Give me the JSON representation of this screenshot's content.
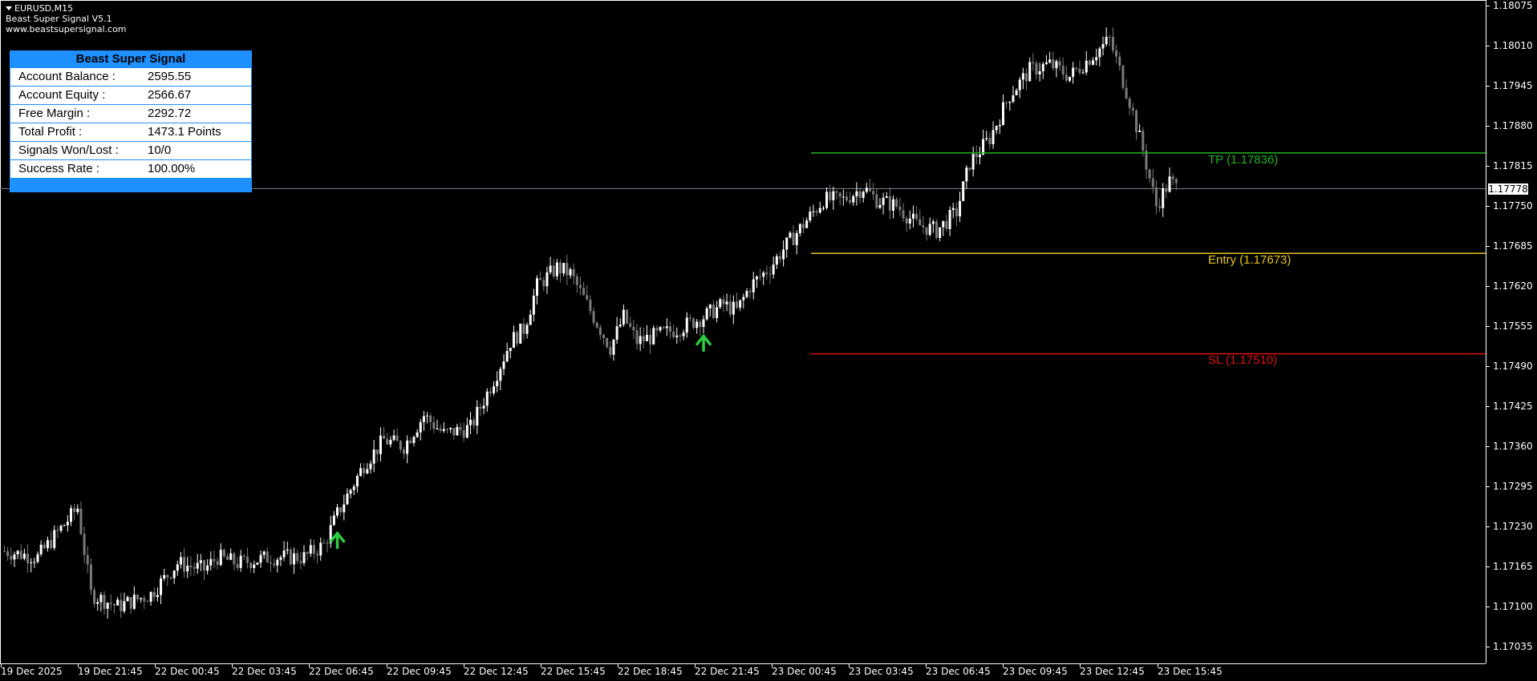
{
  "chart_title": "EURUSD,M15",
  "indicator_name": "Beast Super Signal V5.1",
  "website": "www.beastsupersignal.com",
  "panel": {
    "title": "Beast Super Signal",
    "rows": [
      {
        "label": "Account Balance :",
        "value": "2595.55"
      },
      {
        "label": "Account Equity :",
        "value": "2566.67"
      },
      {
        "label": "Free Margin :",
        "value": "2292.72"
      },
      {
        "label": "Total Profit :",
        "value": "1473.1 Points"
      },
      {
        "label": "Signals Won/Lost :",
        "value": "10/0"
      },
      {
        "label": "Success Rate :",
        "value": "100.00%"
      }
    ]
  },
  "levels": {
    "tp": {
      "label": "TP (1.17836)",
      "price": 1.17836,
      "color": "#22b422"
    },
    "entry": {
      "label": "Entry (1.17673)",
      "price": 1.17673,
      "color": "#e6c419"
    },
    "sl": {
      "label": "SL (1.17510)",
      "price": 1.1751,
      "color": "#e01010"
    }
  },
  "current_price": {
    "label": "1.17778",
    "price": 1.17778
  },
  "chart_data": {
    "type": "candlestick",
    "symbol": "EURUSD",
    "timeframe": "M15",
    "ylim": [
      1.1704,
      1.18075
    ],
    "y_ticks": [
      "1.18075",
      "1.18010",
      "1.17945",
      "1.17880",
      "1.17815",
      "1.17750",
      "1.17685",
      "1.17620",
      "1.17555",
      "1.17490",
      "1.17425",
      "1.17360",
      "1.17295",
      "1.17230",
      "1.17165",
      "1.17100",
      "1.17035"
    ],
    "x_ticks": [
      "19 Dec 2025",
      "19 Dec 21:45",
      "22 Dec 00:45",
      "22 Dec 03:45",
      "22 Dec 06:45",
      "22 Dec 09:45",
      "22 Dec 12:45",
      "22 Dec 15:45",
      "22 Dec 18:45",
      "22 Dec 21:45",
      "23 Dec 00:45",
      "23 Dec 03:45",
      "23 Dec 06:45",
      "23 Dec 09:45",
      "23 Dec 12:45",
      "23 Dec 15:45"
    ],
    "close_path": [
      [
        0,
        1.1719
      ],
      [
        10,
        1.1718
      ],
      [
        22,
        1.1726
      ],
      [
        26,
        1.1712
      ],
      [
        34,
        1.171
      ],
      [
        44,
        1.1712
      ],
      [
        52,
        1.1717
      ],
      [
        60,
        1.1716
      ],
      [
        64,
        1.1718
      ],
      [
        70,
        1.1717
      ],
      [
        80,
        1.1718
      ],
      [
        90,
        1.1718
      ],
      [
        96,
        1.172
      ],
      [
        100,
        1.1725
      ],
      [
        108,
        1.1733
      ],
      [
        114,
        1.1737
      ],
      [
        120,
        1.1736
      ],
      [
        126,
        1.1741
      ],
      [
        132,
        1.1738
      ],
      [
        140,
        1.1739
      ],
      [
        148,
        1.1748
      ],
      [
        152,
        1.1753
      ],
      [
        156,
        1.1755
      ],
      [
        160,
        1.1762
      ],
      [
        166,
        1.1765
      ],
      [
        170,
        1.1764
      ],
      [
        178,
        1.1756
      ],
      [
        182,
        1.1752
      ],
      [
        186,
        1.1757
      ],
      [
        190,
        1.1753
      ],
      [
        196,
        1.1754
      ],
      [
        202,
        1.1755
      ],
      [
        210,
        1.1757
      ],
      [
        216,
        1.1759
      ],
      [
        220,
        1.1758
      ],
      [
        224,
        1.1762
      ],
      [
        230,
        1.1765
      ],
      [
        234,
        1.1768
      ],
      [
        240,
        1.1772
      ],
      [
        246,
        1.1776
      ],
      [
        252,
        1.1776
      ],
      [
        258,
        1.1778
      ],
      [
        262,
        1.1776
      ],
      [
        268,
        1.1775
      ],
      [
        274,
        1.1772
      ],
      [
        280,
        1.1771
      ],
      [
        286,
        1.1774
      ],
      [
        290,
        1.1782
      ],
      [
        296,
        1.1786
      ],
      [
        302,
        1.1793
      ],
      [
        308,
        1.1797
      ],
      [
        314,
        1.1798
      ],
      [
        320,
        1.1796
      ],
      [
        326,
        1.1799
      ],
      [
        332,
        1.1802
      ],
      [
        338,
        1.1792
      ],
      [
        342,
        1.1784
      ],
      [
        346,
        1.1775
      ],
      [
        350,
        1.1779
      ],
      [
        352,
        1.1778
      ]
    ],
    "signals": [
      {
        "type": "buy",
        "index": 100
      },
      {
        "type": "buy",
        "index": 210
      }
    ],
    "candles_note": ""
  }
}
